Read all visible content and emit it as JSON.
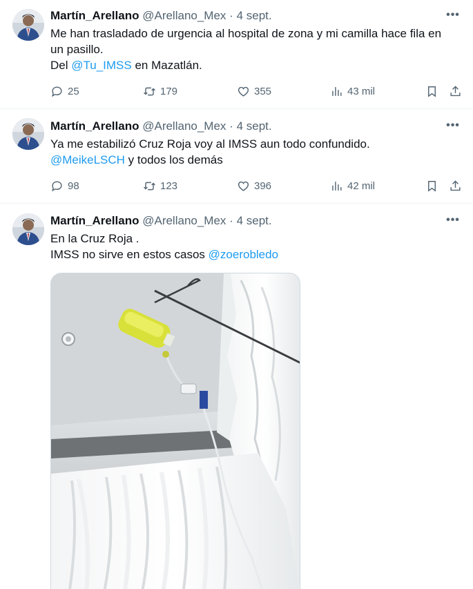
{
  "author": {
    "name": "Martín_Arellano",
    "handle": "@Arellano_Mex",
    "separator": "·"
  },
  "tweets": [
    {
      "date": "4 sept.",
      "lines": [
        {
          "text": "Me han trasladado de urgencia al hospital de zona y mi camilla hace fila en"
        },
        {
          "text": "un pasillo."
        },
        {
          "pre": "Del ",
          "mention": "@Tu_IMSS",
          "post": " en Mazatlán."
        }
      ],
      "replies": "25",
      "retweets": "179",
      "likes": "355",
      "views": "43 mil"
    },
    {
      "date": "4 sept.",
      "lines": [
        {
          "text": "Ya me estabilizó Cruz Roja voy al IMSS aun todo confundido."
        },
        {
          "pre": "",
          "mention": "@MeikeLSCH",
          "post": " y todos los demás"
        }
      ],
      "replies": "98",
      "retweets": "123",
      "likes": "396",
      "views": "42 mil"
    },
    {
      "date": "4 sept.",
      "lines": [
        {
          "text": "En la Cruz Roja ."
        },
        {
          "pre": "IMSS no sirve en estos casos ",
          "mention": "@zoerobledo",
          "post": ""
        }
      ]
    }
  ],
  "icons": {
    "more": "more-dots-icon",
    "reply": "reply-bubble-icon",
    "retweet": "retweet-icon",
    "like": "heart-icon",
    "views": "views-chart-icon",
    "bookmark": "bookmark-icon",
    "share": "share-icon"
  },
  "colors": {
    "text": "#0f1419",
    "secondary": "#536471",
    "mention": "#1d9bf0",
    "divider": "#eff3f4"
  }
}
